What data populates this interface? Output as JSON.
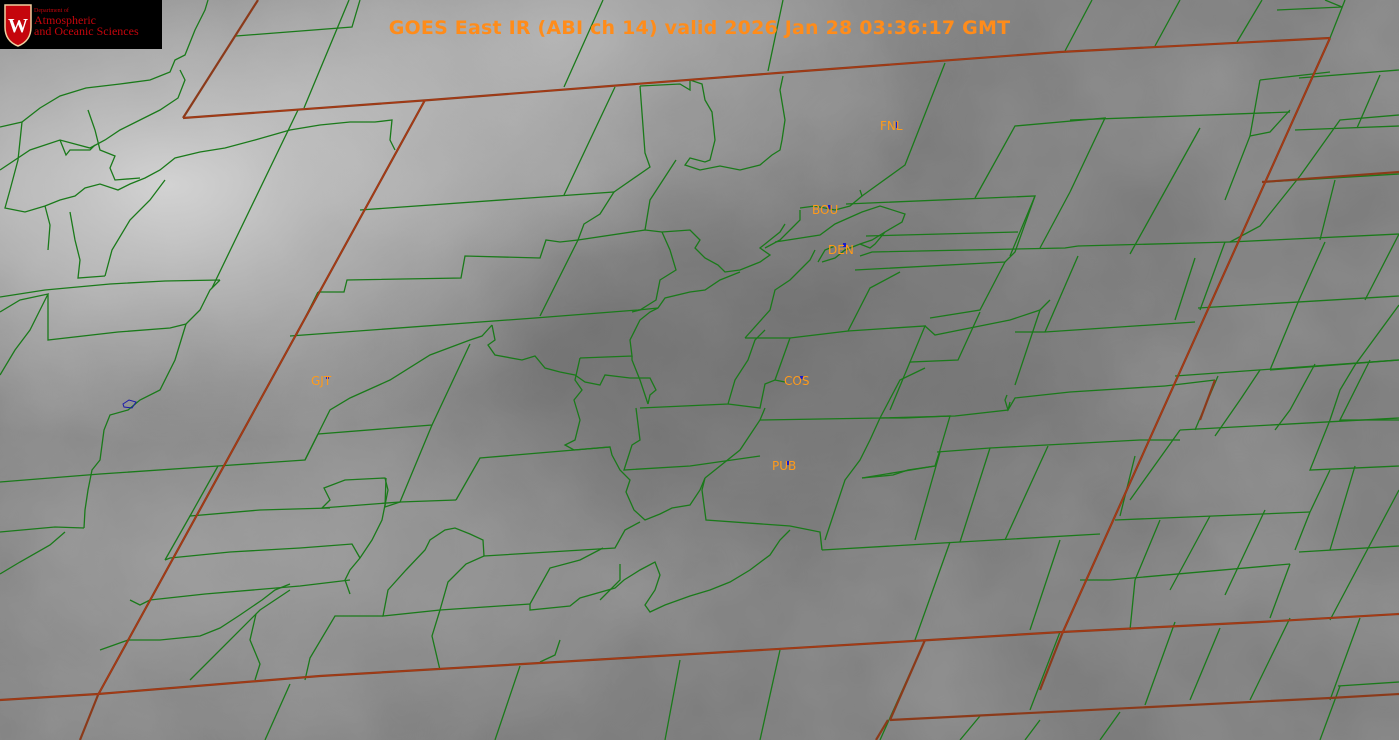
{
  "title": "GOES East IR (ABI ch 14) valid 2026 Jan 28 03:36:17 GMT",
  "logo": {
    "line1": "Department of",
    "line2": "Atmospheric",
    "line3": "and Oceanic Sciences",
    "emblem_letter": "W"
  },
  "stations": [
    {
      "id": "fnl",
      "label": "FNL"
    },
    {
      "id": "bou",
      "label": "BOU"
    },
    {
      "id": "den",
      "label": "DEN"
    },
    {
      "id": "gjt",
      "label": "GJT"
    },
    {
      "id": "cos",
      "label": "COS"
    },
    {
      "id": "pub",
      "label": "PUB"
    }
  ],
  "colors": {
    "background_ir": "#7a7a7a",
    "county_lines": "#1a7a1a",
    "state_lines": "#8b3a1a",
    "station_labels": "#ff9a1a",
    "station_markers": "#1a1acc",
    "title_text": "#ff8c1a",
    "logo_red": "#c5050c"
  }
}
